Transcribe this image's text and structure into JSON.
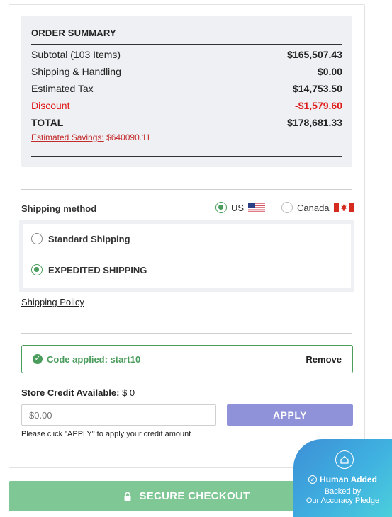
{
  "order_summary": {
    "title": "ORDER SUMMARY",
    "rows": [
      {
        "label": "Subtotal (103 Items)",
        "value": "$165,507.43"
      },
      {
        "label": "Shipping & Handling",
        "value": "$0.00"
      },
      {
        "label": "Estimated Tax",
        "value": "$14,753.50"
      },
      {
        "label": "Discount",
        "value": "-$1,579.60"
      },
      {
        "label": "TOTAL",
        "value": "$178,681.33"
      }
    ],
    "savings_label": "Estimated Savings:",
    "savings_value": "$640090.11",
    "discount_color": "#e01b1b"
  },
  "shipping": {
    "label": "Shipping method",
    "countries": [
      {
        "label": "US",
        "flag": "us-flag-icon",
        "selected": true
      },
      {
        "label": "Canada",
        "flag": "canada-flag-icon",
        "selected": false
      }
    ],
    "methods": [
      {
        "label": "Standard Shipping",
        "selected": false
      },
      {
        "label": "EXPEDITED SHIPPING",
        "selected": true
      }
    ],
    "policy_link": "Shipping Policy"
  },
  "promo": {
    "applied_text": "Code applied: start10",
    "remove_label": "Remove",
    "accent": "#4a9d5c"
  },
  "store_credit": {
    "label": "Store Credit Available:",
    "amount": "$ 0",
    "placeholder": "$0.00",
    "apply_label": "APPLY",
    "note": "Please click \"APPLY\" to apply your credit amount"
  },
  "checkout": {
    "label": "SECURE CHECKOUT",
    "color": "#7fc795"
  },
  "badge": {
    "title": "Human Added",
    "line1": "Backed by",
    "line2": "Our Accuracy Pledge"
  }
}
